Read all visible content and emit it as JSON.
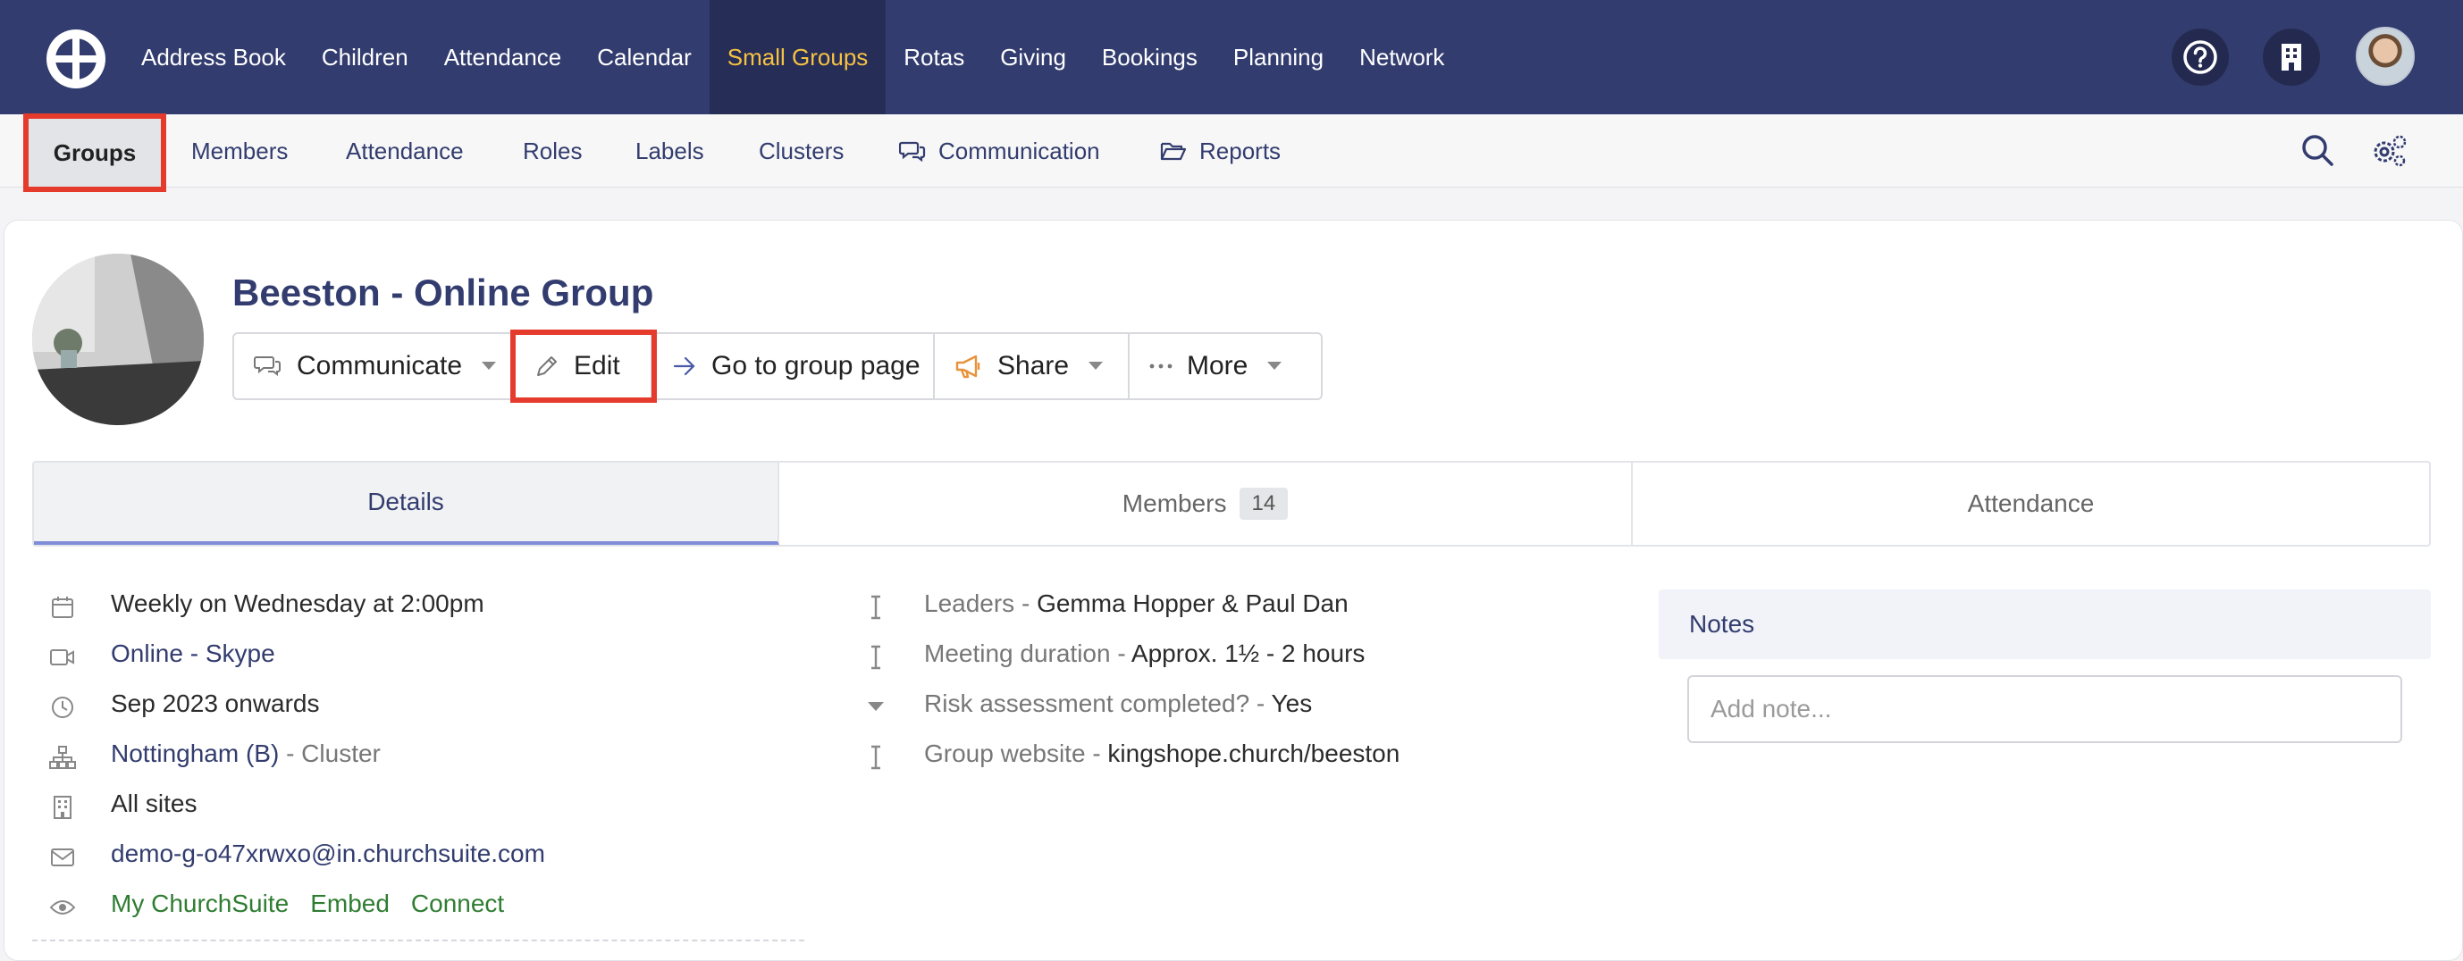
{
  "topnav": {
    "items": [
      {
        "label": "Address Book"
      },
      {
        "label": "Children"
      },
      {
        "label": "Attendance"
      },
      {
        "label": "Calendar"
      },
      {
        "label": "Small Groups",
        "active": true
      },
      {
        "label": "Rotas"
      },
      {
        "label": "Giving"
      },
      {
        "label": "Bookings"
      },
      {
        "label": "Planning"
      },
      {
        "label": "Network"
      }
    ],
    "active_color": "#f6c244",
    "background": "#323c6e"
  },
  "subnav": {
    "groups": "Groups",
    "members": "Members",
    "attendance": "Attendance",
    "roles": "Roles",
    "labels": "Labels",
    "clusters": "Clusters",
    "communication": "Communication",
    "reports": "Reports"
  },
  "group": {
    "title": "Beeston - Online Group"
  },
  "actions": {
    "communicate": "Communicate",
    "edit": "Edit",
    "go_to_group_page": "Go to group page",
    "share": "Share",
    "more": "More"
  },
  "tabs": {
    "details": "Details",
    "members": "Members",
    "members_count": "14",
    "attendance": "Attendance"
  },
  "details": {
    "schedule": "Weekly on Wednesday at 2:00pm",
    "location": "Online - Skype",
    "dates": "Sep 2023 onwards",
    "cluster_name": "Nottingham (B)",
    "cluster_suffix": "- Cluster",
    "sites": "All sites",
    "email": "demo-g-o47xrwxo@in.churchsuite.com",
    "visibility": [
      "My ChurchSuite",
      "Embed",
      "Connect"
    ]
  },
  "custom_fields": {
    "leaders_label": "Leaders -",
    "leaders_value": "Gemma Hopper & Paul Dan",
    "duration_label": "Meeting duration -",
    "duration_value": "Approx. 1½ - 2 hours",
    "risk_label": "Risk assessment completed? -",
    "risk_value": "Yes",
    "website_label": "Group website -",
    "website_value": "kingshope.church/beeston"
  },
  "notes": {
    "title": "Notes",
    "placeholder": "Add note..."
  },
  "highlight_color": "#e53b2c"
}
